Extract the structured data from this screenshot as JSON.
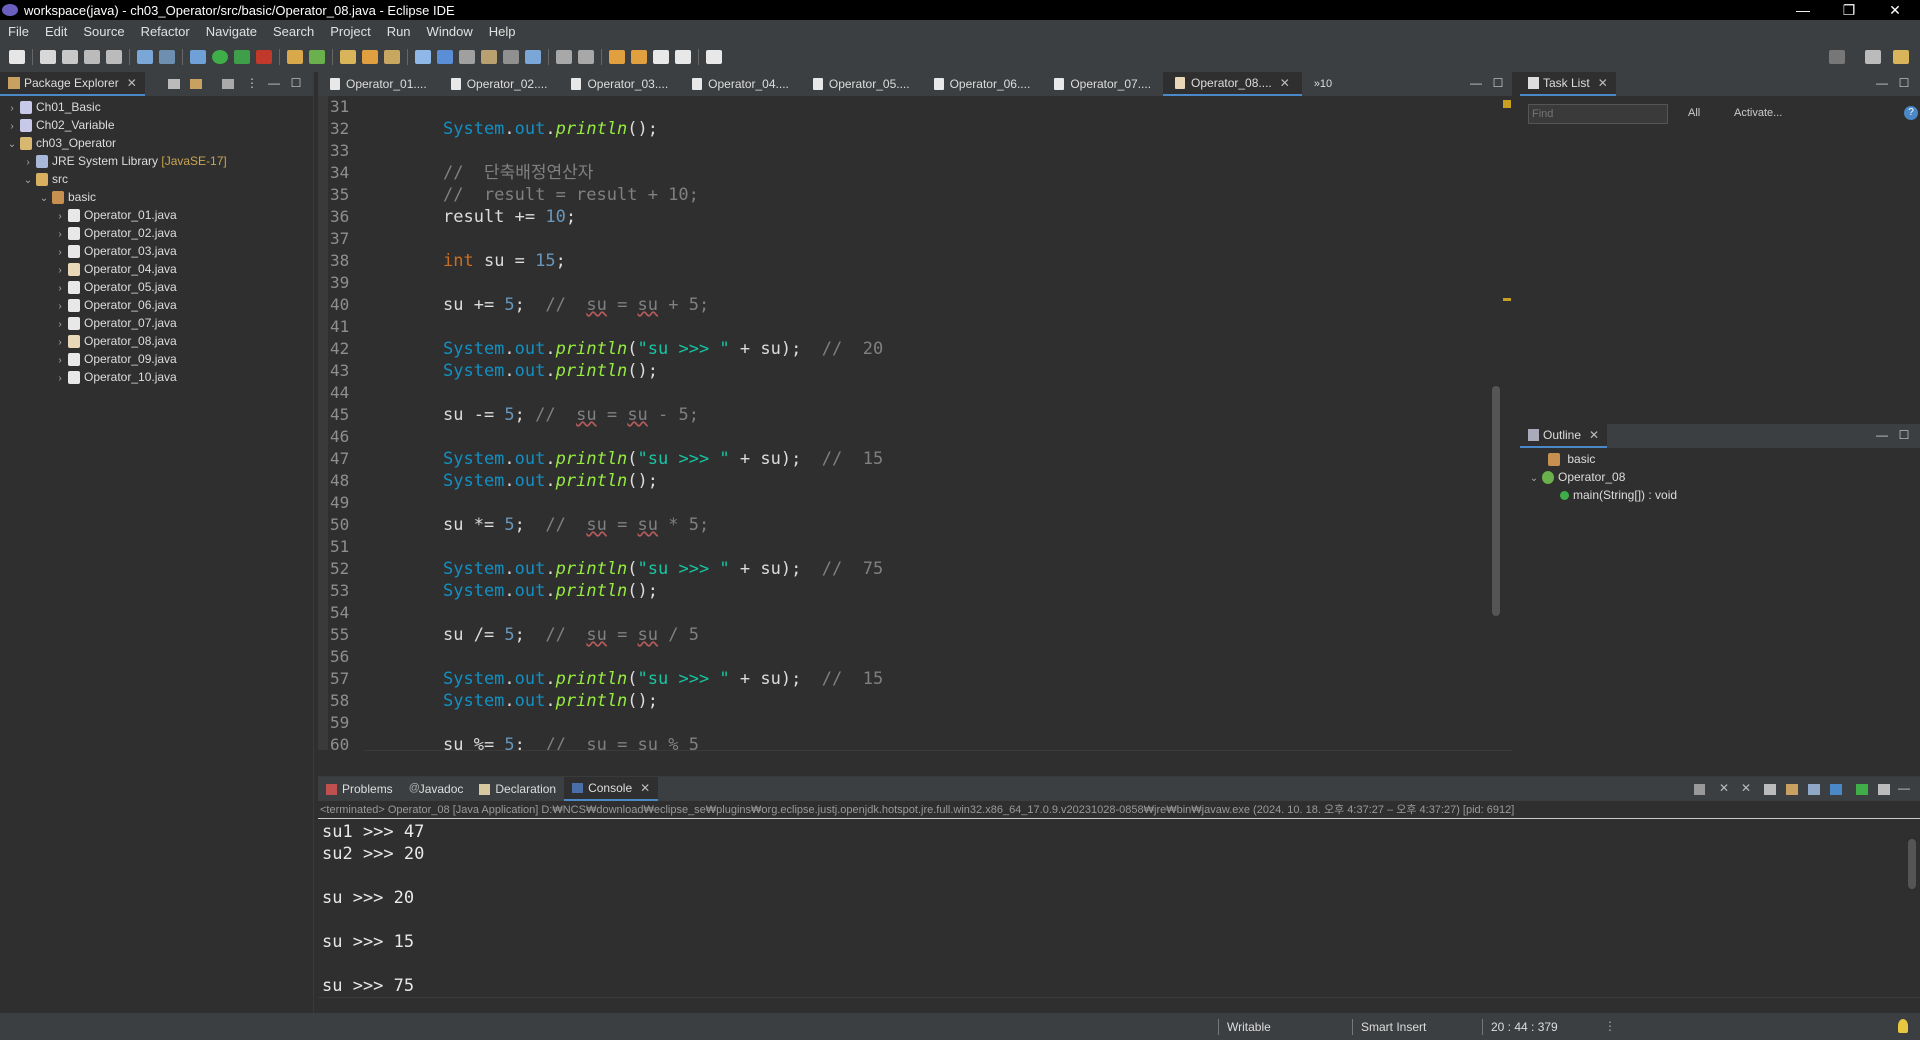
{
  "window": {
    "title": "workspace(java) - ch03_Operator/src/basic/Operator_08.java - Eclipse IDE",
    "minimize": "—",
    "restore": "❐",
    "close": "✕"
  },
  "menu": [
    "File",
    "Edit",
    "Source",
    "Refactor",
    "Navigate",
    "Search",
    "Project",
    "Run",
    "Window",
    "Help"
  ],
  "package_explorer": {
    "title": "Package Explorer",
    "items": [
      {
        "label": "Ch01_Basic",
        "arrow": "›"
      },
      {
        "label": "Ch02_Variable",
        "arrow": "›"
      },
      {
        "label": "ch03_Operator",
        "arrow": "⌄"
      },
      {
        "label": "JRE System Library",
        "lib": "[JavaSE-17]",
        "arrow": "›"
      },
      {
        "label": "src",
        "arrow": "⌄"
      },
      {
        "label": "basic",
        "arrow": "⌄"
      },
      {
        "label": "Operator_01.java",
        "arrow": "›"
      },
      {
        "label": "Operator_02.java",
        "arrow": "›"
      },
      {
        "label": "Operator_03.java",
        "arrow": "›"
      },
      {
        "label": "Operator_04.java",
        "arrow": "›"
      },
      {
        "label": "Operator_05.java",
        "arrow": "›"
      },
      {
        "label": "Operator_06.java",
        "arrow": "›"
      },
      {
        "label": "Operator_07.java",
        "arrow": "›"
      },
      {
        "label": "Operator_08.java",
        "arrow": "›"
      },
      {
        "label": "Operator_09.java",
        "arrow": "›"
      },
      {
        "label": "Operator_10.java",
        "arrow": "›"
      }
    ]
  },
  "editor": {
    "tabs": [
      "Operator_01....",
      "Operator_02....",
      "Operator_03....",
      "Operator_04....",
      "Operator_05....",
      "Operator_06....",
      "Operator_07....",
      "Operator_08...."
    ],
    "active_tab": "Operator_08....",
    "overflow": "»10",
    "line_numbers": [
      "31",
      "32",
      "33",
      "34",
      "35",
      "36",
      "37",
      "38",
      "39",
      "40",
      "41",
      "42",
      "43",
      "44",
      "45",
      "46",
      "47",
      "48",
      "49",
      "50",
      "51",
      "52",
      "53",
      "54",
      "55",
      "56",
      "57",
      "58",
      "59",
      "60"
    ]
  },
  "task_list": {
    "title": "Task List",
    "find_placeholder": "Find",
    "all": "All",
    "activate": "Activate..."
  },
  "outline": {
    "title": "Outline",
    "package": "basic",
    "class": "Operator_08",
    "method": "main(String[]) : void"
  },
  "bottom_tabs": [
    "Problems",
    "Javadoc",
    "Declaration",
    "Console"
  ],
  "console": {
    "terminated": "<terminated> Operator_08 [Java Application] D:₩NCS₩download₩eclipse_se₩plugins₩org.eclipse.justj.openjdk.hotspot.jre.full.win32.x86_64_17.0.9.v20231028-0858₩jre₩bin₩javaw.exe  (2024. 10. 18. 오후 4:37:27 – 오후 4:37:27) [pid: 6912]",
    "lines": [
      "su1 >>> 47",
      "su2 >>> 20",
      "",
      "su >>> 20",
      "",
      "su >>> 15",
      "",
      "su >>> 75"
    ]
  },
  "status": {
    "writable": "Writable",
    "insert": "Smart Insert",
    "position": "20 : 44 : 379"
  },
  "colors": {
    "accent": "#4a88c7",
    "keyword": "#cc6c1d",
    "field": "#1290c3",
    "method": "#96ec3f",
    "string": "#17c6a3",
    "comment": "#808080",
    "number": "#6897bb"
  }
}
